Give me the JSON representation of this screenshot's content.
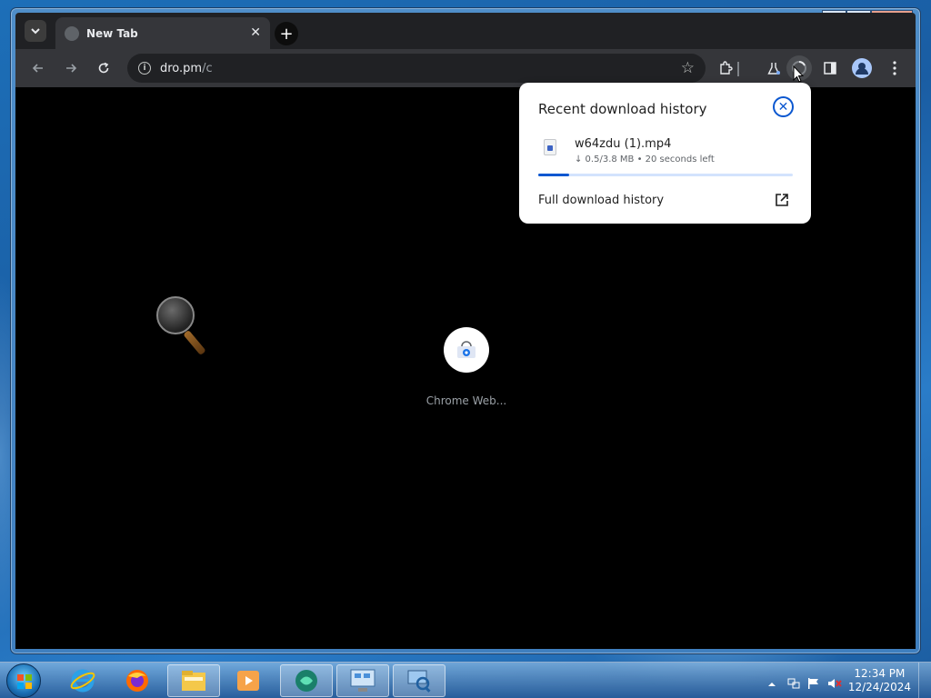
{
  "browser": {
    "tab": {
      "title": "New Tab",
      "close_glyph": "✕"
    },
    "new_tab_glyph": "+",
    "address": {
      "host": "dro.pm",
      "path": "/c"
    }
  },
  "window_controls": {
    "minimize": "▁",
    "maximize": "□",
    "close": "✕"
  },
  "shortcut": {
    "label": "Chrome Web...",
    "icon": "chrome-web-store-icon"
  },
  "downloads_bubble": {
    "title": "Recent download history",
    "item": {
      "filename": "w64zdu (1).mp4",
      "status": "↓ 0.5/3.8 MB • 20 seconds left",
      "progress_fraction": 0.12
    },
    "full_history_label": "Full download history"
  },
  "taskbar": {
    "apps": [
      "internet-explorer-icon",
      "firefox-icon",
      "file-explorer-icon",
      "media-player-icon",
      "app-icon-active",
      "control-panel-icon",
      "network-icon"
    ],
    "clock": {
      "time": "12:34 PM",
      "date": "12/24/2024"
    }
  },
  "colors": {
    "accent": "#0b57d0",
    "chrome_dark": "#202124",
    "toolbar": "#35363a"
  }
}
